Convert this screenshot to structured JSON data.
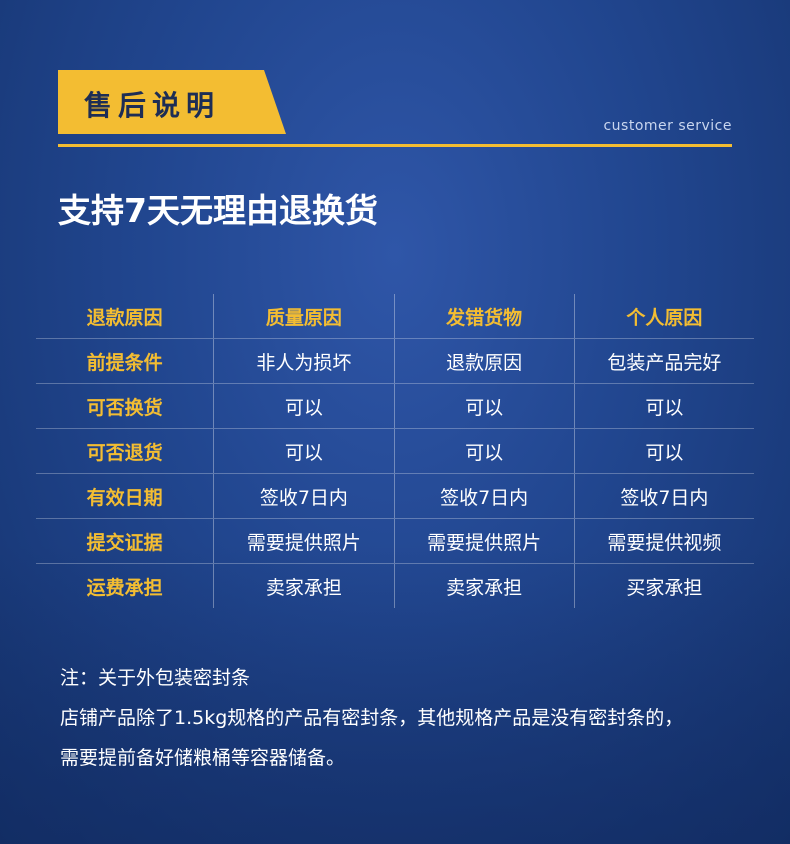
{
  "header": {
    "title": "售后说明",
    "subtitle": "customer service"
  },
  "headline": "支持7天无理由退换货",
  "table": {
    "columns": [
      "退款原因",
      "质量原因",
      "发错货物",
      "个人原因"
    ],
    "rows": [
      [
        "前提条件",
        "非人为损坏",
        "退款原因",
        "包装产品完好"
      ],
      [
        "可否换货",
        "可以",
        "可以",
        "可以"
      ],
      [
        "可否退货",
        "可以",
        "可以",
        "可以"
      ],
      [
        "有效日期",
        "签收7日内",
        "签收7日内",
        "签收7日内"
      ],
      [
        "提交证据",
        "需要提供照片",
        "需要提供照片",
        "需要提供视频"
      ],
      [
        "运费承担",
        "卖家承担",
        "卖家承担",
        "买家承担"
      ]
    ]
  },
  "notes": [
    "注：关于外包装密封条",
    "店铺产品除了1.5kg规格的产品有密封条，其他规格产品是没有密封条的，",
    "需要提前备好储粮桶等容器储备。"
  ],
  "colors": {
    "accent": "#f3bd32",
    "background": "#21468f"
  }
}
